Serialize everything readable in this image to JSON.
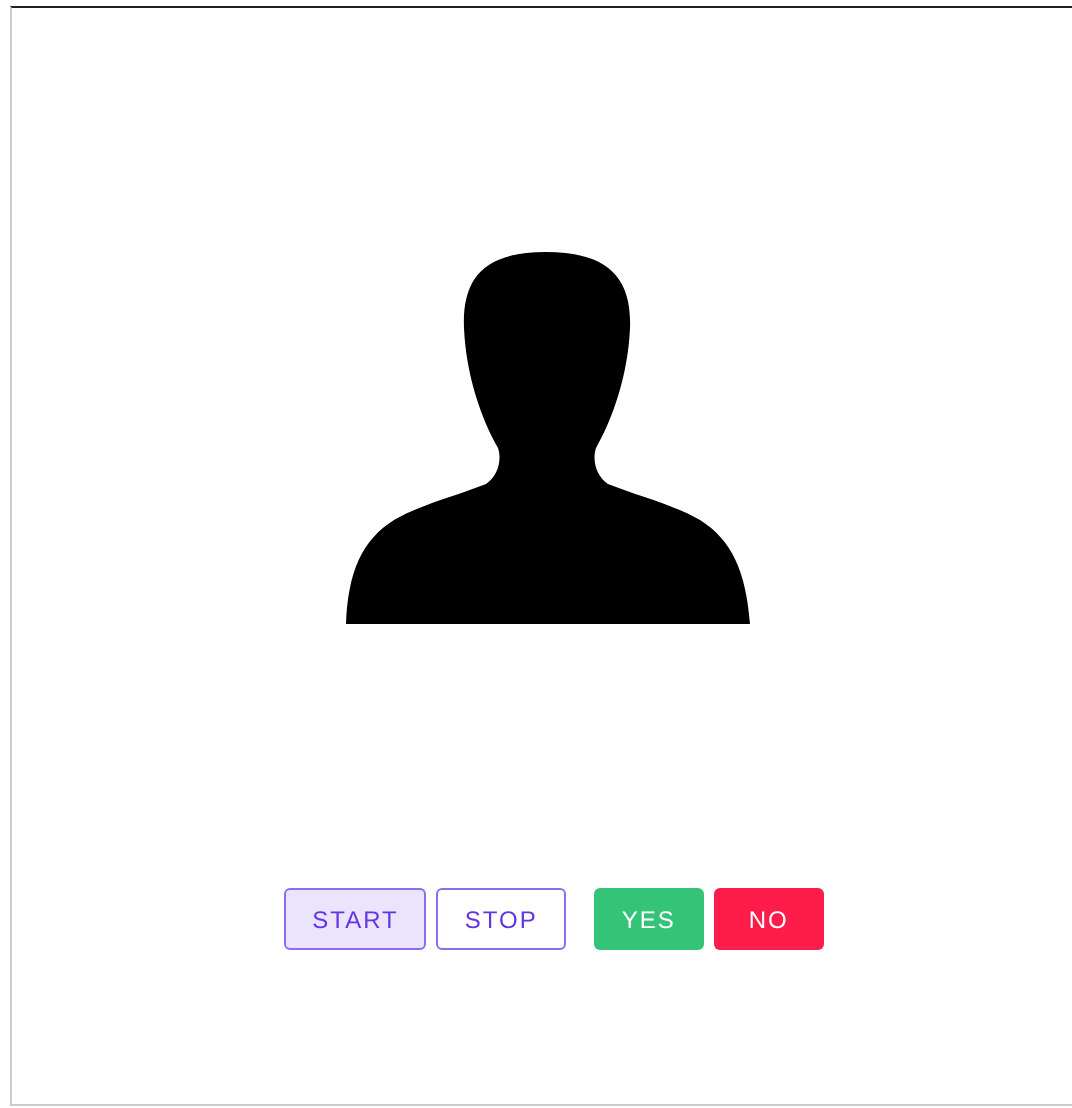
{
  "avatar": {
    "kind": "silhouette"
  },
  "buttons": [
    {
      "kind": "toggle",
      "label": "START",
      "selected": true
    },
    {
      "kind": "toggle",
      "label": "STOP",
      "selected": false
    },
    {
      "kind": "action",
      "label": "YES",
      "color": "#35c477"
    },
    {
      "kind": "action",
      "label": "NO",
      "color": "#fe1d4a"
    }
  ]
}
